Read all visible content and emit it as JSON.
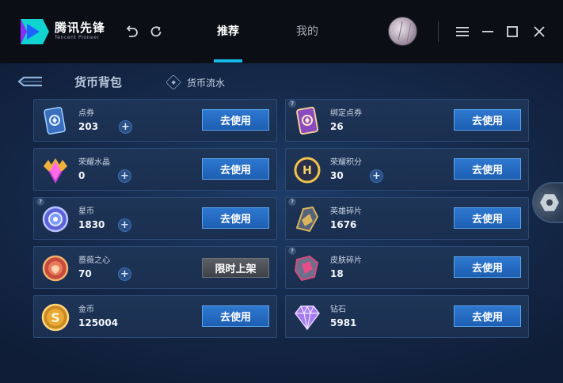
{
  "app": {
    "logo_cn": "腾讯先锋",
    "logo_en": "Tencent Pioneer"
  },
  "titlebar": {
    "tabs": [
      {
        "label": "推荐",
        "active": true
      },
      {
        "label": "我的",
        "active": false
      }
    ],
    "icons": [
      "undo-icon",
      "refresh-icon",
      "menu-icon",
      "minimize-icon",
      "maximize-icon",
      "close-icon"
    ]
  },
  "header": {
    "title": "货币背包",
    "flow_link": "货币流水"
  },
  "buttons": {
    "use": "去使用",
    "limited": "限时上架"
  },
  "currencies": [
    {
      "name": "点券",
      "amount": "203",
      "icon": "coupon-card-icon",
      "plus": true,
      "action": "use",
      "help": false
    },
    {
      "name": "绑定点券",
      "amount": "26",
      "icon": "bound-coupon-card-icon",
      "plus": false,
      "action": "use",
      "help": true
    },
    {
      "name": "荣耀水晶",
      "amount": "0",
      "icon": "glory-crystal-icon",
      "plus": true,
      "action": "use",
      "help": false
    },
    {
      "name": "荣耀积分",
      "amount": "30",
      "icon": "glory-points-icon",
      "plus": true,
      "action": "use",
      "help": false
    },
    {
      "name": "星币",
      "amount": "1830",
      "icon": "star-coin-icon",
      "plus": true,
      "action": "use",
      "help": true
    },
    {
      "name": "英雄碎片",
      "amount": "1676",
      "icon": "hero-fragment-icon",
      "plus": false,
      "action": "use",
      "help": true
    },
    {
      "name": "蔷薇之心",
      "amount": "70",
      "icon": "rose-heart-icon",
      "plus": true,
      "action": "limited",
      "help": false
    },
    {
      "name": "皮肤碎片",
      "amount": "18",
      "icon": "skin-fragment-icon",
      "plus": false,
      "action": "use",
      "help": true
    },
    {
      "name": "金币",
      "amount": "125004",
      "icon": "gold-coin-icon",
      "plus": false,
      "action": "use",
      "help": false
    },
    {
      "name": "钻石",
      "amount": "5981",
      "icon": "diamond-icon",
      "plus": false,
      "action": "use",
      "help": false
    }
  ],
  "colors": {
    "accent": "#15b8e6",
    "button_blue": "#2e78d0",
    "button_gray": "#4a4e55",
    "card_bg": "#1c3354"
  }
}
